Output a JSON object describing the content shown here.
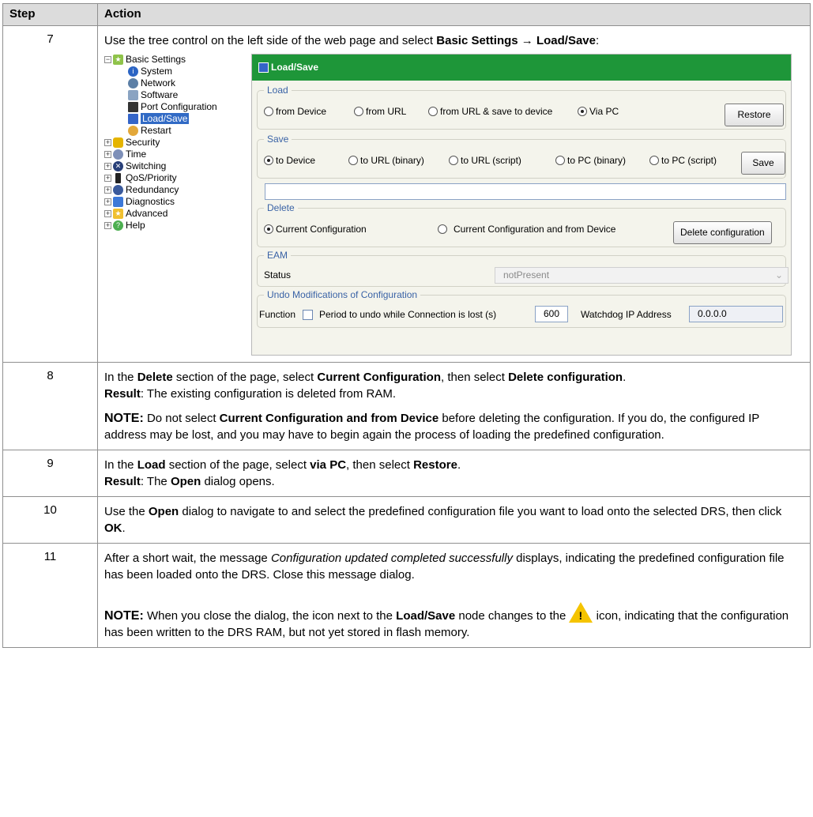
{
  "header": {
    "step": "Step",
    "action": "Action"
  },
  "step7": {
    "num": "7",
    "text_pre": "Use the tree control on the left side of the web page and select ",
    "text_bold": "Basic Settings → Load/Save",
    "text_post": ":",
    "tree": {
      "root": "Basic Settings",
      "children": [
        "System",
        "Network",
        "Software",
        "Port Configuration",
        "Load/Save",
        "Restart"
      ],
      "items": [
        "Security",
        "Time",
        "Switching",
        "QoS/Priority",
        "Redundancy",
        "Diagnostics",
        "Advanced",
        "Help"
      ]
    },
    "panel": {
      "title": "Load/Save",
      "load": {
        "legend": "Load",
        "opt1": "from Device",
        "opt2": "from URL",
        "opt3": "from URL & save to device",
        "opt4": "Via PC",
        "button": "Restore"
      },
      "save": {
        "legend": "Save",
        "opt1": "to Device",
        "opt2": "to URL (binary)",
        "opt3": "to URL (script)",
        "opt4": "to PC (binary)",
        "opt5": "to PC (script)",
        "button": "Save"
      },
      "del": {
        "legend": "Delete",
        "opt1": "Current Configuration",
        "opt2": "Current Configuration and from Device",
        "button": "Delete configuration"
      },
      "eam": {
        "legend": "EAM",
        "status_label": "Status",
        "status_value": "notPresent"
      },
      "undo": {
        "legend": "Undo Modifications of Configuration",
        "function_label": "Function",
        "period_label": "Period to undo while Connection is lost (s)",
        "period_value": "600",
        "watchdog_label": "Watchdog IP Address",
        "watchdog_value": "0.0.0.0"
      }
    }
  },
  "step8": {
    "num": "8",
    "a1": "In the ",
    "b1": "Delete",
    "a2": " section of the page, select ",
    "b2": "Current Configuration",
    "a3": ", then select ",
    "b3": "Delete configuration",
    "a4": ".",
    "result_label": "Result",
    "result_text": ": The existing configuration is deleted from RAM.",
    "note_label": "NOTE:",
    "note_a": " Do not select ",
    "note_b": "Current Configuration and from Device",
    "note_c": " before deleting the configuration. If you do, the configured IP address may be lost, and you may have to begin again the process of loading the predefined configuration."
  },
  "step9": {
    "num": "9",
    "a1": "In the ",
    "b1": "Load",
    "a2": " section of the page, select ",
    "b2": "via PC",
    "a3": ", then select ",
    "b3": "Restore",
    "a4": ".",
    "result_label": "Result",
    "r1": ": The ",
    "rb": "Open",
    "r2": " dialog opens."
  },
  "step10": {
    "num": "10",
    "a1": "Use the ",
    "b1": "Open",
    "a2": " dialog to navigate to and select the predefined configuration file you want to load onto the selected DRS, then click ",
    "b2": "OK",
    "a3": "."
  },
  "step11": {
    "num": "11",
    "a1": "After a short wait, the message ",
    "i1": "Configuration updated completed successfully",
    "a2": " displays, indicating the predefined configuration file has been loaded onto the DRS. Close this message dialog.",
    "note_label": "NOTE:",
    "n1": " When you close the dialog, the icon next to the ",
    "nb": "Load/Save",
    "n2": " node changes to the ",
    "n3": " icon, indicating that the configuration has been written to the DRS RAM, but not yet stored in flash memory."
  }
}
